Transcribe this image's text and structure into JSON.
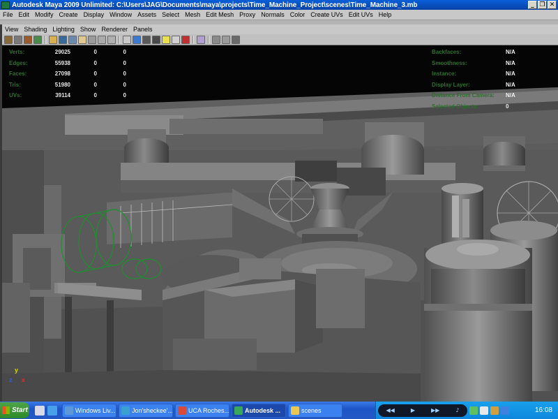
{
  "window": {
    "title": "Autodesk Maya 2009 Unlimited: C:\\Users\\JAG\\Documents\\maya\\projects\\Time_Machine_Project\\scenes\\Time_Machine_3.mb",
    "minimize": "_",
    "restore": "❐",
    "close": "✕"
  },
  "menubar": {
    "items": [
      "File",
      "Edit",
      "Modify",
      "Create",
      "Display",
      "Window",
      "Assets",
      "Select",
      "Mesh",
      "Edit Mesh",
      "Proxy",
      "Normals",
      "Color",
      "Create UVs",
      "Edit UVs",
      "Help"
    ]
  },
  "panel_menu": {
    "items": [
      "View",
      "Shading",
      "Lighting",
      "Show",
      "Renderer",
      "Panels"
    ]
  },
  "hud_stats": [
    {
      "label": "Verts:",
      "v1": "29025",
      "v2": "0",
      "v3": "0"
    },
    {
      "label": "Edges:",
      "v1": "55938",
      "v2": "0",
      "v3": "0"
    },
    {
      "label": "Faces:",
      "v1": "27098",
      "v2": "0",
      "v3": "0"
    },
    {
      "label": "Tris:",
      "v1": "51980",
      "v2": "0",
      "v3": "0"
    },
    {
      "label": "UVs:",
      "v1": "39114",
      "v2": "0",
      "v3": "0"
    }
  ],
  "hud_info": [
    {
      "label": "Backfaces:",
      "value": "N/A"
    },
    {
      "label": "Smoothness:",
      "value": "N/A"
    },
    {
      "label": "Instance:",
      "value": "N/A"
    },
    {
      "label": "Display Layer:",
      "value": "N/A"
    },
    {
      "label": "Distance From Camera:",
      "value": "N/A"
    },
    {
      "label": "Selected Objects:",
      "value": "0"
    }
  ],
  "axis": {
    "y": "y",
    "x": "x",
    "z": "z"
  },
  "taskbar": {
    "start": "Start",
    "tasks": [
      "Windows Liv...",
      "Jon'sheckee'...",
      "UCA Roches...",
      "Autodesk ...",
      "scenes"
    ],
    "clock": "16:08"
  },
  "colors": {
    "titlebar": "#0842a6",
    "hud_label": "#2e6f2e",
    "viewport_bg": "#5c5c5c",
    "selection_wire": "#1f8f2f"
  }
}
